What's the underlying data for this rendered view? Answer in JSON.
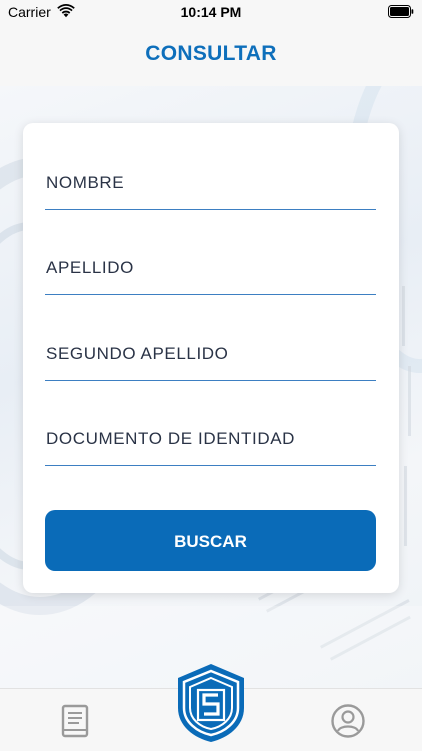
{
  "status_bar": {
    "carrier": "Carrier",
    "time": "10:14 PM",
    "wifi_icon": "wifi-icon",
    "battery_icon": "battery-icon"
  },
  "nav": {
    "title": "CONSULTAR"
  },
  "form": {
    "fields": [
      {
        "placeholder": "NOMBRE",
        "value": ""
      },
      {
        "placeholder": "APELLIDO",
        "value": ""
      },
      {
        "placeholder": "SEGUNDO APELLIDO",
        "value": ""
      },
      {
        "placeholder": "DOCUMENTO DE IDENTIDAD",
        "value": ""
      }
    ],
    "submit_label": "BUSCAR"
  },
  "tab_bar": {
    "left_icon": "book-icon",
    "center_icon": "shield-logo-icon",
    "right_icon": "user-profile-icon"
  },
  "colors": {
    "accent": "#0e6fbb",
    "button": "#0a6bb8",
    "underline": "#3d7fc2",
    "text": "#2a3346"
  }
}
